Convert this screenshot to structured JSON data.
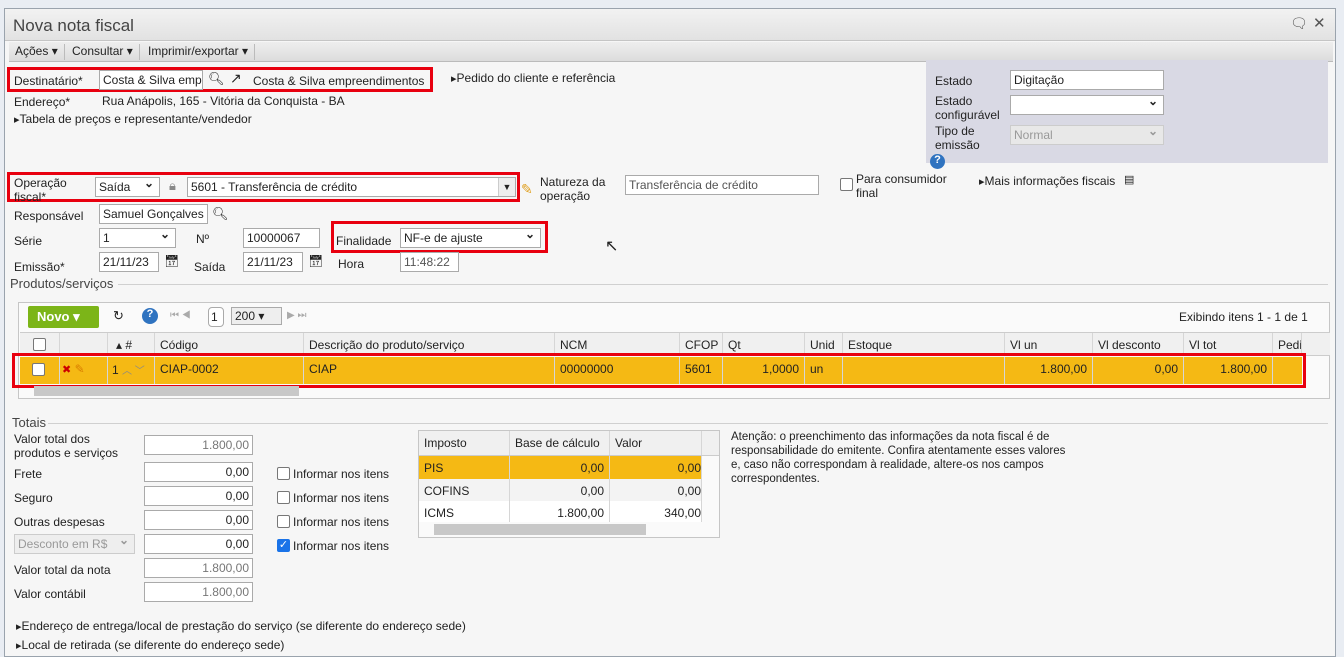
{
  "window": {
    "title": "Nova nota fiscal"
  },
  "menu": [
    "Ações",
    "Consultar",
    "Imprimir/exportar"
  ],
  "header": {
    "destinatario_label": "Destinatário*",
    "destinatario_value": "Costa & Silva empreendimentos",
    "destinatario_link": "Costa & Silva empreendimentos",
    "pedido_link": "Pedido do cliente e referência",
    "endereco_label": "Endereço*",
    "endereco_value": "Rua Anápolis, 165 - Vitória da Conquista - BA",
    "tabela_link": "Tabela de preços e representante/vendedor",
    "operacao_label1": "Operação",
    "operacao_label2": "fiscal*",
    "operacao_tipo": "Saída",
    "operacao_value": "5601 - Transferência de crédito",
    "natureza_label1": "Natureza da",
    "natureza_label2": "operação",
    "natureza_value": "Transferência de crédito",
    "consumidor_label1": "Para consumidor",
    "consumidor_label2": "final",
    "mais_info": "Mais informações fiscais",
    "responsavel_label": "Responsável",
    "responsavel_value": "Samuel Gonçalves",
    "serie_label": "Série",
    "serie_value": "1",
    "numero_label": "Nº",
    "numero_value": "10000067",
    "finalidade_label": "Finalidade",
    "finalidade_value": "NF-e de ajuste",
    "emissao_label": "Emissão*",
    "emissao_value": "21/11/23",
    "saida_label": "Saída",
    "saida_value": "21/11/23",
    "hora_label": "Hora",
    "hora_value": "11:48:22"
  },
  "status_panel": {
    "estado_label": "Estado",
    "estado_value": "Digitação",
    "config_label1": "Estado",
    "config_label2": "configurável",
    "config_value": "",
    "tipo_label1": "Tipo de",
    "tipo_label2": "emissão",
    "tipo_value": "Normal"
  },
  "products": {
    "section": "Produtos/serviços",
    "new_button": "Novo",
    "page": "1",
    "page_size": "200",
    "showing": "Exibindo itens 1 - 1 de 1",
    "columns": [
      "#",
      "Código",
      "Descrição do produto/serviço",
      "NCM",
      "CFOP",
      "Qt",
      "Unid",
      "Estoque",
      "Vl un",
      "Vl desconto",
      "Vl tot",
      "Pedi"
    ],
    "rows": [
      {
        "n": "1",
        "codigo": "CIAP-0002",
        "descricao": "CIAP",
        "ncm": "00000000",
        "cfop": "5601",
        "qt": "1,0000",
        "unid": "un",
        "estoque": "",
        "vl_un": "1.800,00",
        "vl_desc": "0,00",
        "vl_tot": "1.800,00"
      }
    ]
  },
  "totais": {
    "section": "Totais",
    "produtos_label1": "Valor total dos",
    "produtos_label2": "produtos e serviços",
    "produtos_value": "1.800,00",
    "frete_label": "Frete",
    "frete_value": "0,00",
    "seguro_label": "Seguro",
    "seguro_value": "0,00",
    "outras_label": "Outras despesas",
    "outras_value": "0,00",
    "desconto_type": "Desconto em R$",
    "desconto_value": "0,00",
    "nota_label": "Valor total da nota",
    "nota_value": "1.800,00",
    "contabil_label": "Valor contábil",
    "contabil_value": "1.800,00",
    "informar": "Informar nos itens"
  },
  "impostos": {
    "columns": [
      "Imposto",
      "Base de cálculo",
      "Valor"
    ],
    "rows": [
      {
        "imposto": "PIS",
        "base": "0,00",
        "valor": "0,00"
      },
      {
        "imposto": "COFINS",
        "base": "0,00",
        "valor": "0,00"
      },
      {
        "imposto": "ICMS",
        "base": "1.800,00",
        "valor": "340,00"
      }
    ]
  },
  "atencao": "Atenção: o preenchimento das informações da nota fiscal é de responsabilidade do emitente. Confira atentamente esses valores e, caso não correspondam à realidade, altere-os nos campos correspondentes.",
  "links": {
    "entrega": "Endereço de entrega/local de prestação do serviço (se diferente do endereço sede)",
    "retirada": "Local de retirada (se diferente do endereço sede)"
  }
}
